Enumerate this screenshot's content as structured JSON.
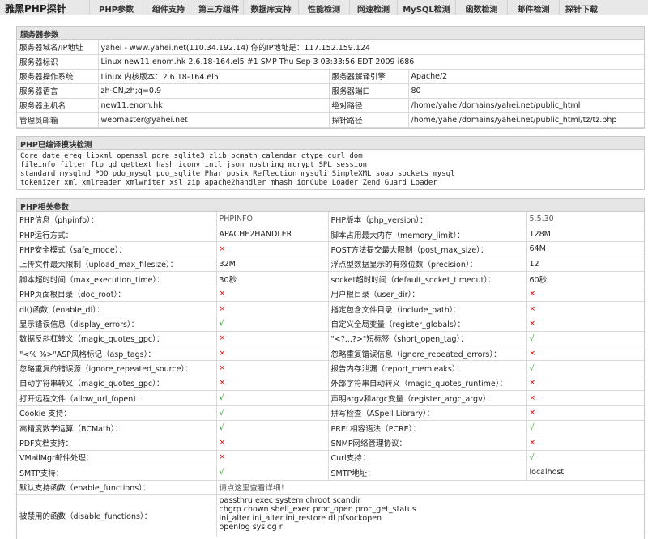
{
  "nav": {
    "brand": "雅黑PHP探针",
    "items": [
      "PHP参数",
      "组件支持",
      "第三方组件",
      "数据库支持",
      "性能检测",
      "网速检测",
      "MySQL检测",
      "函数检测",
      "邮件检测",
      "探针下载"
    ]
  },
  "server": {
    "title": "服务器参数",
    "domain_label": "服务器域名/IP地址",
    "domain_value": "yahei - www.yahei.net(110.34.192.14)  你的IP地址是：117.152.159.124",
    "ident_label": "服务器标识",
    "ident_value": "Linux new11.enom.hk 2.6.18-164.el5 #1 SMP Thu Sep 3 03:33:56 EDT 2009 i686",
    "os_label": "服务器操作系统",
    "os_value": "Linux  内核版本：2.6.18-164.el5",
    "engine_label": "服务器解译引擎",
    "engine_value": "Apache/2",
    "lang_label": "服务器语言",
    "lang_value": "zh-CN,zh;q=0.9",
    "port_label": "服务器端口",
    "port_value": "80",
    "host_label": "服务器主机名",
    "host_value": "new11.enom.hk",
    "abspath_label": "绝对路径",
    "abspath_value": "/home/yahei/domains/yahei.net/public_html",
    "admin_label": "管理员邮箱",
    "admin_value": "webmaster@yahei.net",
    "probe_label": "探针路径",
    "probe_value": "/home/yahei/domains/yahei.net/public_html/tz/tz.php"
  },
  "modules": {
    "title": "PHP已编译模块检测",
    "lines": [
      "Core  date  ereg  libxml  openssl  pcre  sqlite3  zlib  bcmath  calendar  ctype  curl  dom",
      "fileinfo  filter  ftp  gd  gettext  hash  iconv  intl  json  mbstring  mcrypt  SPL  session",
      "standard  mysqlnd  PDO  pdo_mysql  pdo_sqlite  Phar  posix  Reflection  mysqli  SimpleXML  soap  sockets  mysql",
      "tokenizer  xml  xmlreader  xmlwriter  xsl  zip  apache2handler  mhash  ionCube Loader  Zend Guard Loader"
    ]
  },
  "php": {
    "title": "PHP相关参数",
    "rows": [
      [
        "PHP信息（phpinfo）：",
        "PHPINFO",
        "PHP版本（php_version）：",
        "5.5.30"
      ],
      [
        "PHP运行方式：",
        "APACHE2HANDLER",
        "脚本占用最大内存（memory_limit）：",
        "128M"
      ],
      [
        "PHP安全模式（safe_mode）：",
        "×",
        "POST方法提交最大限制（post_max_size）：",
        "64M"
      ],
      [
        "上传文件最大限制（upload_max_filesize）：",
        "32M",
        "浮点型数据显示的有效位数（precision）：",
        "12"
      ],
      [
        "脚本超时时间（max_execution_time）：",
        "30秒",
        "socket超时时间（default_socket_timeout）：",
        "60秒"
      ],
      [
        "PHP页面根目录（doc_root）：",
        "×",
        "用户根目录（user_dir）：",
        "×"
      ],
      [
        "dl()函数（enable_dl）：",
        "×",
        "指定包含文件目录（include_path）：",
        "×"
      ],
      [
        "显示错误信息（display_errors）：",
        "√",
        "自定义全局变量（register_globals）：",
        "×"
      ],
      [
        "数据反斜杠转义（magic_quotes_gpc）：",
        "×",
        "\"<?...?>\"短标签（short_open_tag）：",
        "√"
      ],
      [
        "\"<% %>\"ASP风格标记（asp_tags）：",
        "×",
        "忽略重复错误信息（ignore_repeated_errors）：",
        "×"
      ],
      [
        "忽略重复的错误源（ignore_repeated_source）：",
        "×",
        "报告内存泄漏（report_memleaks）：",
        "√"
      ],
      [
        "自动字符串转义（magic_quotes_gpc）：",
        "×",
        "外部字符串自动转义（magic_quotes_runtime）：",
        "×"
      ],
      [
        "打开远程文件（allow_url_fopen）：",
        "√",
        "声明argv和argc变量（register_argc_argv）：",
        "×"
      ],
      [
        "Cookie 支持：",
        "√",
        "拼写检查（ASpell Library）：",
        "×"
      ],
      [
        "高精度数学运算（BCMath）：",
        "√",
        "PREL相容语法（PCRE）：",
        "√"
      ],
      [
        "PDF文档支持：",
        "×",
        "SNMP网络管理协议：",
        "×"
      ],
      [
        "VMailMgr邮件处理：",
        "×",
        "Curl支持：",
        "√"
      ],
      [
        "SMTP支持：",
        "√",
        "SMTP地址：",
        "localhost"
      ]
    ],
    "enable_functions_label": "默认支持函数（enable_functions）：",
    "enable_functions_value": "请点这里查看详细！",
    "disable_functions_label": "被禁用的函数（disable_functions）：",
    "disable_functions_lines": [
      "passthru  exec  system  chroot  scandir",
      "chgrp  chown  shell_exec  proc_open  proc_get_status",
      "ini_alter  ini_alter  ini_restore  dl  pfsockopen",
      "openlog  syslog  r"
    ]
  }
}
